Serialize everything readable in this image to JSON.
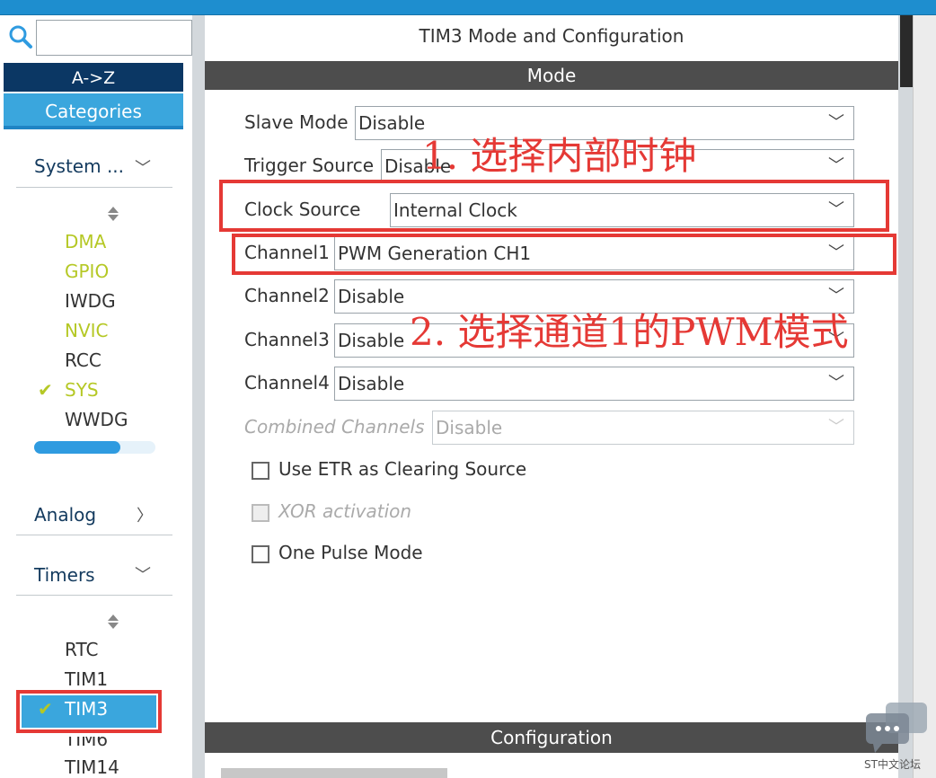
{
  "header": {
    "title": "TIM3 Mode and Configuration"
  },
  "sidebar": {
    "tabs": {
      "az": "A->Z",
      "categories": "Categories"
    },
    "sections": {
      "system": "System ...",
      "analog": "Analog",
      "timers": "Timers"
    },
    "system_items": [
      "DMA",
      "GPIO",
      "IWDG",
      "NVIC",
      "RCC",
      "SYS",
      "WWDG"
    ],
    "timer_items": [
      "RTC",
      "TIM1",
      "TIM3",
      "TIM6",
      "TIM14"
    ]
  },
  "mode": {
    "section_label": "Mode",
    "slave_mode": {
      "label": "Slave Mode",
      "value": "Disable"
    },
    "trigger_source": {
      "label": "Trigger Source",
      "value": "Disable"
    },
    "clock_source": {
      "label": "Clock Source",
      "value": "Internal Clock"
    },
    "channel1": {
      "label": "Channel1",
      "value": "PWM Generation CH1"
    },
    "channel2": {
      "label": "Channel2",
      "value": "Disable"
    },
    "channel3": {
      "label": "Channel3",
      "value": "Disable"
    },
    "channel4": {
      "label": "Channel4",
      "value": "Disable"
    },
    "combined": {
      "label": "Combined Channels",
      "value": "Disable"
    },
    "checkboxes": {
      "etr": "Use ETR as Clearing Source",
      "xor": "XOR activation",
      "one_pulse": "One Pulse Mode"
    }
  },
  "annotations": {
    "step1": "1. 选择内部时钟",
    "step2": "2. 选择通道1的PWM模式"
  },
  "configuration": {
    "section_label": "Configuration"
  },
  "watermark": "ST中文论坛",
  "colors": {
    "accent": "#3aa6dd",
    "annotation_red": "#e53935",
    "enabled_green": "#b5c825"
  }
}
